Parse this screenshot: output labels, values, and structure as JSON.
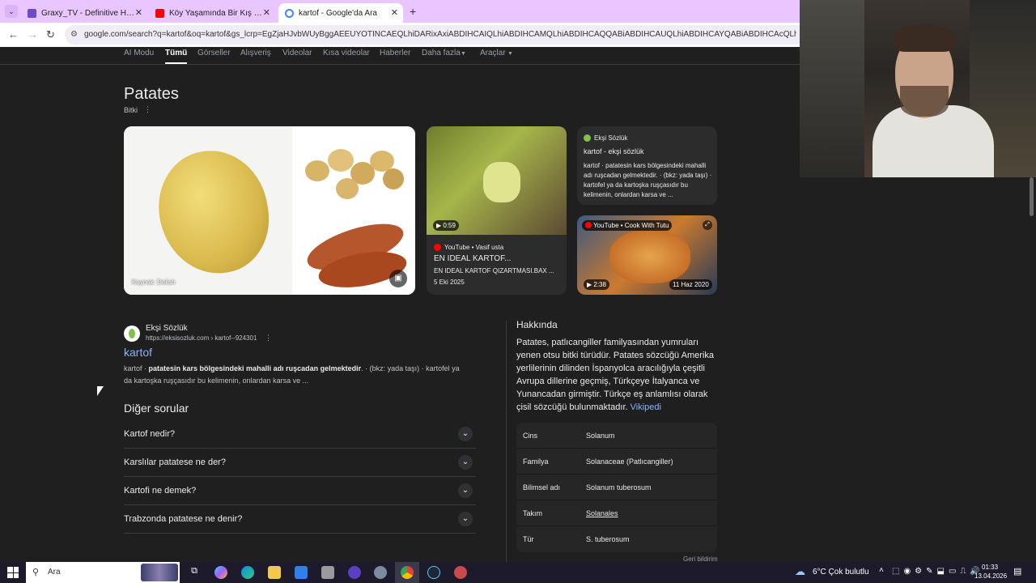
{
  "browser": {
    "tabs": [
      {
        "title": "Graxy_TV - Definitive Hero Sieg",
        "favicon_color": "#6b4bc6"
      },
      {
        "title": "Köy Yaşamında Bir Kış Günü | S",
        "favicon_color": "#ff0000"
      },
      {
        "title": "kartof - Google'da Ara",
        "favicon_color": "#4285f4"
      }
    ],
    "url": "google.com/search?q=kartof&oq=kartof&gs_lcrp=EgZjaHJvbWUyBggAEEUYOTINCAEQLhiDARixAxiABDIHCAIQLhiABDIHCAMQLhiABDIHCAQQABiABDIHCAUQLhiABDIHCAYQABiABDIHCAcQLhiABDIHCAgQABiABDIHCAkQ"
  },
  "search_tabs": [
    "AI Modu",
    "Tümü",
    "Görseller",
    "Alışveriş",
    "Videolar",
    "Kısa videolar",
    "Haberler",
    "Daha fazla",
    "Araçlar"
  ],
  "kp": {
    "title": "Patates",
    "subtitle": "Bitki",
    "image_source": "Kaynak: Delish",
    "video1": {
      "duration": "0:59",
      "source": "YouTube • Vasif usta",
      "title": "EN IDEAL KARTOF...",
      "desc": "EN IDEAL KARTOF QIZARTMASI.BAX ...",
      "date": "5 Eki 2025"
    },
    "eksi_card": {
      "source": "Ekşi Sözlük",
      "title": "kartof - ekşi sözlük",
      "desc": "kartof · patatesin kars bölgesindeki mahalli adı ruşcadan gelmektedir. · (bkz: yada taşı) · kartofel ya da kartoşka ruşçasıdır bu kelimenin, onlardan karsa ve ..."
    },
    "video2": {
      "source": "YouTube • Cook With Tutu",
      "duration": "2:38",
      "date": "11 Haz 2020"
    }
  },
  "result": {
    "site": "Ekşi Sözlük",
    "url": "https://eksisozluk.com › kartof--924301",
    "title": "kartof",
    "snippet_pre": "kartof · ",
    "snippet_bold": "patatesin kars bölgesindeki mahalli adı ruşcadan gelmektedir",
    "snippet_post": ". · (bkz: yada taşı) · kartofel ya",
    "snippet_line2": "da kartoşka ruşçasıdır bu kelimenin, onlardan karsa ve ..."
  },
  "paa": {
    "heading": "Diğer sorular",
    "questions": [
      "Kartof nedir?",
      "Karslılar patatese ne der?",
      "Kartofi ne demek?",
      "Trabzonda patatese ne denir?"
    ]
  },
  "about": {
    "heading": "Hakkında",
    "text": "Patates, patlıcangiller familyasından yumruları yenen otsu bitki türüdür. Patates sözcüğü Amerika yerlilerinin dilinden İspanyolca aracılığıyla çeşitli Avrupa dillerine geçmiş, Türkçeye İtalyanca ve Yunancadan girmiştir. Türkçe eş anlamlısı olarak çisil sözcüğü bulunmaktadır.",
    "link": "Vikipedi",
    "facts": [
      {
        "k": "Cins",
        "v": "Solanum"
      },
      {
        "k": "Familya",
        "v": "Solanaceae (Patlıcangiller)"
      },
      {
        "k": "Bilimsel adı",
        "v": "Solanum tuberosum"
      },
      {
        "k": "Takım",
        "v": "Solanales"
      },
      {
        "k": "Tür",
        "v": "S. tuberosum"
      }
    ],
    "feedback": "Geri bildirim"
  },
  "taskbar": {
    "search_placeholder": "Ara",
    "weather": "6°C  Çok bulutlu",
    "time": "01:33",
    "date": "13.04.2026"
  }
}
